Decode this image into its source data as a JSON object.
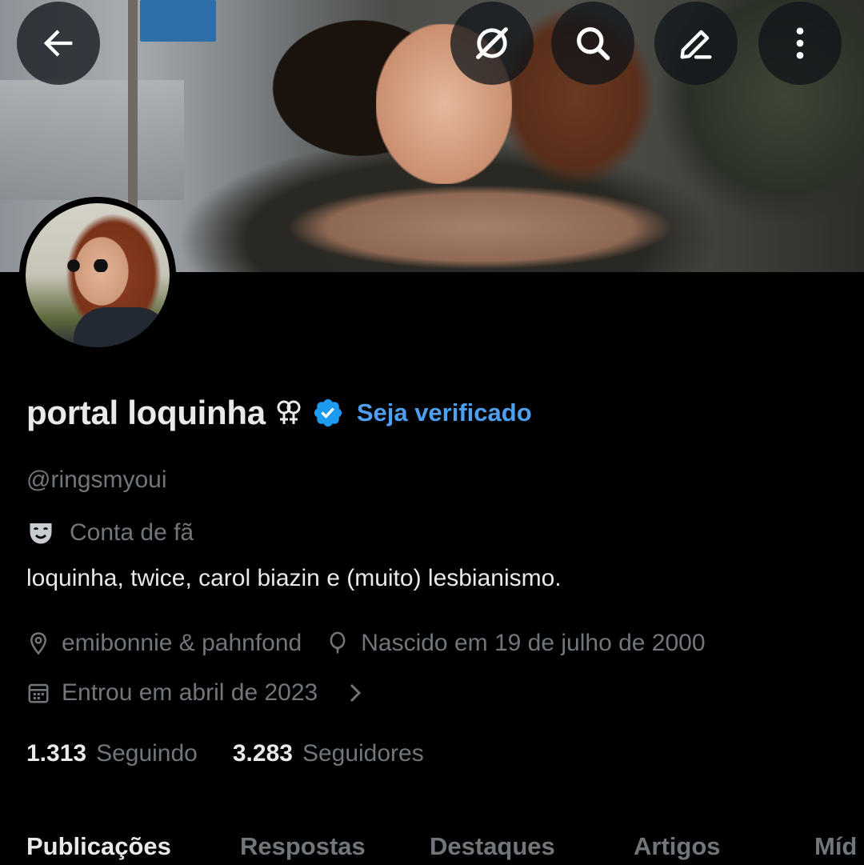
{
  "header": {
    "back_icon": "arrow-left-icon",
    "grok_icon": "grok-icon",
    "search_icon": "search-icon",
    "edit_icon": "edit-icon",
    "more_icon": "more-vertical-icon"
  },
  "profile": {
    "display_name": "portal loquinha",
    "name_emoji": "⚢",
    "verified_badge_icon": "verified-badge-icon",
    "get_verified_label": "Seja verificado",
    "handle": "@ringsmyoui",
    "category_icon": "theater-masks-icon",
    "category": "Conta de fã",
    "bio": "loquinha, twice, carol biazin e (muito) lesbianismo.",
    "location": "emibonnie & pahnfond",
    "birthday": "Nascido em 19 de julho de 2000",
    "joined": "Entrou em abril de 2023",
    "following_count": "1.313",
    "following_label": "Seguindo",
    "followers_count": "3.283",
    "followers_label": "Seguidores"
  },
  "tabs": [
    {
      "label": "Publicações",
      "active": true
    },
    {
      "label": "Respostas",
      "active": false
    },
    {
      "label": "Destaques",
      "active": false
    },
    {
      "label": "Artigos",
      "active": false
    },
    {
      "label": "Míd",
      "active": false
    }
  ],
  "colors": {
    "background": "#000000",
    "primary_text": "#e7e9ea",
    "secondary_text": "#71767b",
    "accent": "#4d9ff0",
    "verified_badge": "#1d9bf0"
  }
}
